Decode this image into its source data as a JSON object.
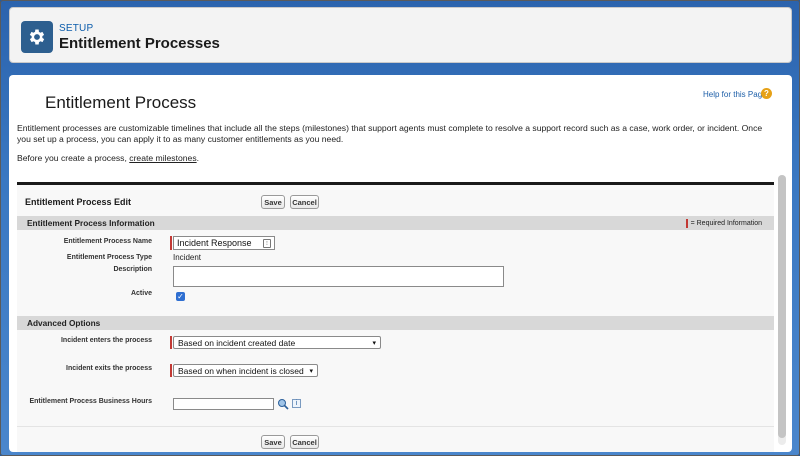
{
  "header": {
    "label": "SETUP",
    "title": "Entitlement Processes",
    "icon": "gear-icon"
  },
  "page": {
    "title": "Entitlement Process",
    "help_link": "Help for this Page",
    "help_icon_glyph": "?",
    "intro_text": "Entitlement processes are customizable timelines that include all the steps (milestones) that support agents must complete to resolve a support record such as a case, work order, or incident. Once you set up a process, you can apply it to as many customer entitlements as you need.",
    "before_text": "Before you create a process, ",
    "create_link": "create milestones",
    "before_suffix": "."
  },
  "edit": {
    "title": "Entitlement Process Edit",
    "save_label": "Save",
    "cancel_label": "Cancel"
  },
  "info_section": {
    "title": "Entitlement Process Information",
    "required_legend": "= Required Information",
    "name_label": "Entitlement Process Name",
    "name_value": "Incident Response",
    "type_label": "Entitlement Process Type",
    "type_value": "Incident",
    "description_label": "Description",
    "description_value": "",
    "active_label": "Active",
    "active_checked": true
  },
  "advanced_section": {
    "title": "Advanced Options",
    "enters_label": "Incident enters the process",
    "enters_value": "Based on incident created date",
    "exits_label": "Incident exits the process",
    "exits_value": "Based on when incident is closed",
    "hours_label": "Entitlement Process Business Hours",
    "hours_value": ""
  },
  "colors": {
    "accent": "#0b5cab",
    "required": "#c23934",
    "setup_icon_bg": "#2d5f8f",
    "help_icon": "#e6a117",
    "checkbox": "#2f6fd1"
  }
}
